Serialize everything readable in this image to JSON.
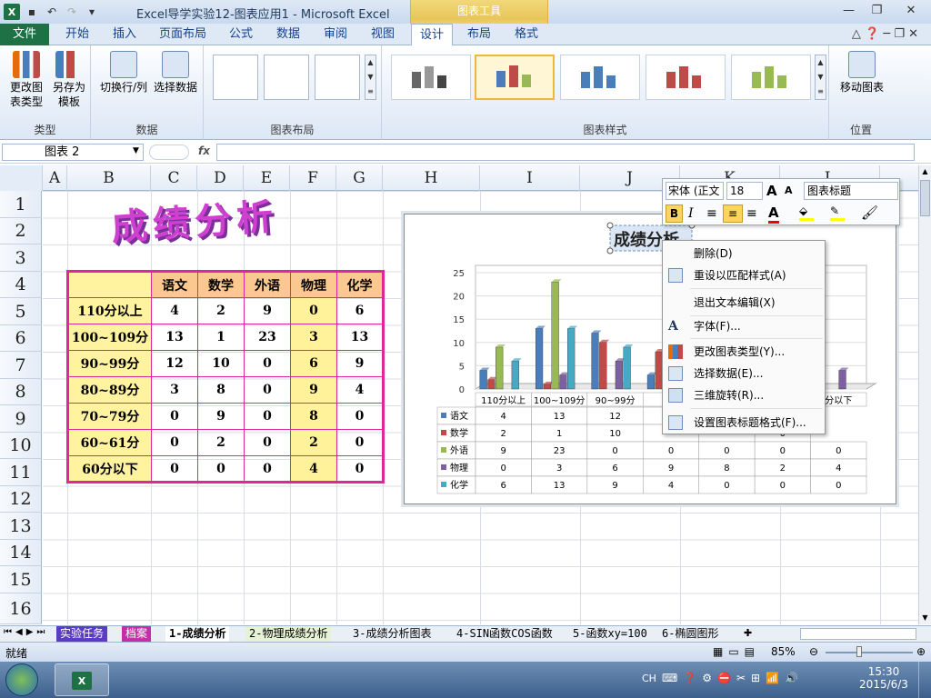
{
  "window": {
    "title": "Excel导学实验12-图表应用1 - Microsoft Excel",
    "tool_tab_group": "图表工具"
  },
  "tabs": [
    "文件",
    "开始",
    "插入",
    "页面布局",
    "公式",
    "数据",
    "审阅",
    "视图",
    "设计",
    "布局",
    "格式"
  ],
  "ribbon": {
    "groups": {
      "type": "类型",
      "data": "数据",
      "layout": "图表布局",
      "styles": "图表样式",
      "location": "位置"
    },
    "change_chart_type": "更改图表类型",
    "save_as_template": "另存为模板",
    "switch_row_col": "切换行/列",
    "select_data": "选择数据",
    "move_chart": "移动图表"
  },
  "formula_bar": {
    "name_box": "图表 2",
    "fx": "fx",
    "value": ""
  },
  "columns": [
    "A",
    "B",
    "C",
    "D",
    "E",
    "F",
    "G",
    "H",
    "I",
    "J",
    "K",
    "L"
  ],
  "rows": [
    "1",
    "2",
    "3",
    "4",
    "5",
    "6",
    "7",
    "8",
    "9",
    "10",
    "11",
    "12",
    "13",
    "14",
    "15",
    "16"
  ],
  "sheet_title": "成绩分析",
  "table": {
    "headers": [
      "",
      "语文",
      "数学",
      "外语",
      "物理",
      "化学"
    ],
    "rows": [
      [
        "110分以上",
        "4",
        "2",
        "9",
        "0",
        "6"
      ],
      [
        "100~109分",
        "13",
        "1",
        "23",
        "3",
        "13"
      ],
      [
        "90~99分",
        "12",
        "10",
        "0",
        "6",
        "9"
      ],
      [
        "80~89分",
        "3",
        "8",
        "0",
        "9",
        "4"
      ],
      [
        "70~79分",
        "0",
        "9",
        "0",
        "8",
        "0"
      ],
      [
        "60~61分",
        "0",
        "2",
        "0",
        "2",
        "0"
      ],
      [
        "60分以下",
        "0",
        "0",
        "0",
        "4",
        "0"
      ]
    ]
  },
  "chart_data": {
    "type": "bar",
    "title": "成绩分析",
    "categories": [
      "110分以上",
      "100~109分",
      "90~99分",
      "80~89分",
      "70~79分",
      "60~61分",
      "60分以下"
    ],
    "visible_category_labels": [
      "110分以上",
      "100~109分",
      "90~99分",
      "80~",
      "",
      "",
      "分以下"
    ],
    "series": [
      {
        "name": "语文",
        "values": [
          4,
          13,
          12,
          3,
          0,
          0,
          0
        ]
      },
      {
        "name": "数学",
        "values": [
          2,
          1,
          10,
          8,
          9,
          2,
          0
        ]
      },
      {
        "name": "外语",
        "values": [
          9,
          23,
          0,
          0,
          0,
          0,
          0
        ]
      },
      {
        "name": "物理",
        "values": [
          0,
          3,
          6,
          9,
          8,
          2,
          4
        ]
      },
      {
        "name": "化学",
        "values": [
          6,
          13,
          9,
          4,
          0,
          0,
          0
        ]
      }
    ],
    "ylim": [
      0,
      25
    ],
    "yticks": [
      "0",
      "5",
      "10",
      "15",
      "20",
      "25"
    ],
    "colors": [
      "#4a7ebb",
      "#be4b48",
      "#98b954",
      "#7d60a0",
      "#46aac5"
    ],
    "data_table_visible": [
      [
        "4",
        "13",
        "12",
        "",
        "",
        "0"
      ],
      [
        "2",
        "1",
        "10",
        "",
        "",
        "0"
      ],
      [
        "9",
        "23",
        "0",
        "0",
        "0",
        "0",
        "0"
      ],
      [
        "0",
        "3",
        "6",
        "9",
        "8",
        "2",
        "4"
      ],
      [
        "6",
        "13",
        "9",
        "4",
        "0",
        "0",
        "0"
      ]
    ]
  },
  "mini_toolbar": {
    "font": "宋体 (正文",
    "size": "18",
    "style_box": "图表标题"
  },
  "context_menu": [
    "删除(D)",
    "重设以匹配样式(A)",
    "退出文本编辑(X)",
    "字体(F)...",
    "更改图表类型(Y)...",
    "选择数据(E)...",
    "三维旋转(R)...",
    "设置图表标题格式(F)..."
  ],
  "sheets": [
    "实验任务",
    "档案",
    "1-成绩分析",
    "2-物理成绩分析",
    "3-成绩分析图表",
    "4-SIN函数COS函数",
    "5-函数xy=100",
    "6-椭圆图形"
  ],
  "status": {
    "ready": "就绪",
    "zoom": "85%"
  },
  "taskbar": {
    "lang": "CH",
    "time": "15:30",
    "date": "2015/6/3"
  }
}
